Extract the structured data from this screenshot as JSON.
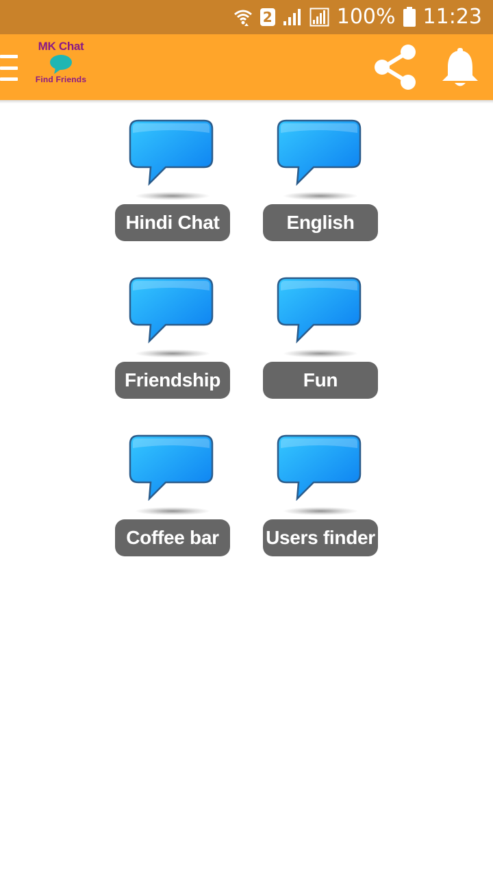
{
  "status_bar": {
    "sim_slot": "2",
    "battery": "100%",
    "time": "11:23",
    "icons": [
      "wifi-icon",
      "sim-badge",
      "signal-icon",
      "signal-icon",
      "battery-icon"
    ]
  },
  "app_bar": {
    "logo_title": "MK Chat",
    "logo_subtitle": "Find Friends",
    "background": "#ffa52a",
    "icons": [
      "menu-icon",
      "share-icon",
      "bell-icon"
    ]
  },
  "chat_rooms": [
    {
      "label": "Hindi Chat"
    },
    {
      "label": "English"
    },
    {
      "label": "Friendship"
    },
    {
      "label": "Fun"
    },
    {
      "label": "Coffee bar"
    },
    {
      "label": "Users finder"
    }
  ],
  "colors": {
    "status_bar": "#c9822a",
    "app_bar": "#ffa52a",
    "button": "#666666",
    "bubble": "#1aa3ff",
    "logo_text": "#8a1a86"
  }
}
